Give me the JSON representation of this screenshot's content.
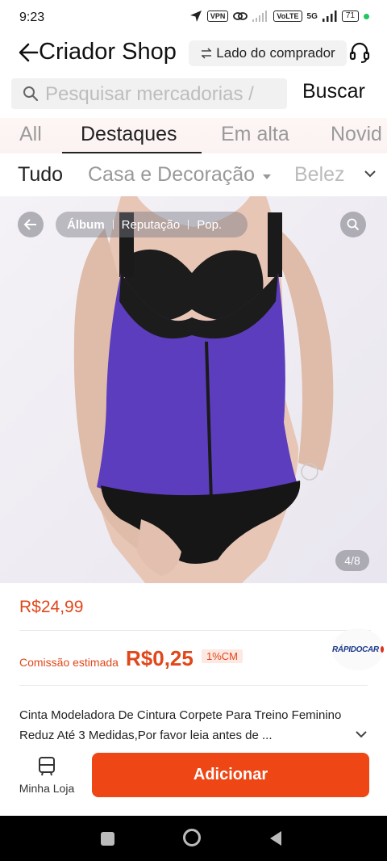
{
  "status_bar": {
    "time": "9:23",
    "vpn": "VPN",
    "net_label": "5G",
    "battery": "71"
  },
  "header": {
    "title": "Criador Shop",
    "switch_label": "Lado do comprador"
  },
  "search": {
    "placeholder": "Pesquisar mercadorias /",
    "button_label": "Buscar"
  },
  "tabs": [
    "All",
    "Destaques",
    "Em alta",
    "Novid"
  ],
  "categories": {
    "items": [
      "Tudo",
      "Casa e Decoração",
      "Belez"
    ]
  },
  "gallery": {
    "segments": [
      "Álbum",
      "Reputação",
      "Pop."
    ],
    "pager": "4/8"
  },
  "product": {
    "price": "R$24,99",
    "commission_label": "Comissão estimada",
    "commission_value": "R$0,25",
    "commission_rate": "1%CM",
    "brand_badge": "RÁPIDOCAR",
    "title": "Cinta Modeladora De Cintura Corpete Para Treino Feminino Reduz Até 3 Medidas,Por favor leia antes de ..."
  },
  "bottom": {
    "store_label": "Minha Loja",
    "add_label": "Adicionar"
  },
  "colors": {
    "accent": "#ee4614",
    "price": "#e0471a"
  }
}
